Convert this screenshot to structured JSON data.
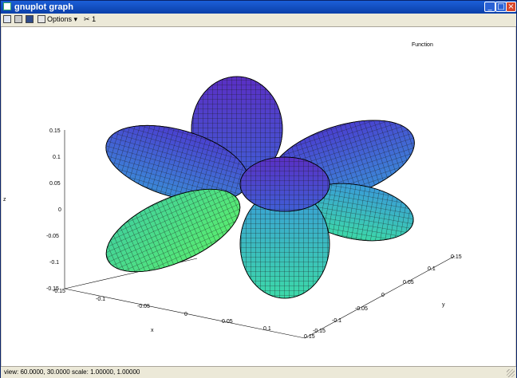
{
  "window": {
    "title": "gnuplot graph",
    "icons": {
      "app": "gnuplot-icon",
      "minimize": "minimize-icon",
      "maximize": "maximize-icon",
      "close": "close-icon"
    }
  },
  "toolbar": {
    "copy_icon": "copy-icon",
    "print_icon": "print-icon",
    "save_icon": "save-icon",
    "options_label": "Options",
    "options_arrow": "▾",
    "mouse_icon": "mouse-icon",
    "mouse_count": "1"
  },
  "plot": {
    "title": "Function",
    "z_ticks": [
      "0.15",
      "0.1",
      "0.05",
      "0",
      "-0.05",
      "-0.1",
      "-0.15"
    ],
    "x_ticks": [
      "-0.15",
      "-0.1",
      "-0.05",
      "0",
      "0.05",
      "0.1",
      "0.15"
    ],
    "y_ticks": [
      "-0.15",
      "-0.1",
      "-0.05",
      "0",
      "0.05",
      "0.1",
      "0.15"
    ],
    "x_label": "x",
    "y_label": "y",
    "z_label": "z",
    "colors": {
      "purple": "#5a35c8",
      "blue": "#3d6fd8",
      "teal": "#2fd8b8",
      "green": "#4ee870",
      "mesh": "#1a1a1a"
    }
  },
  "status": {
    "text": "view: 60.0000, 30.0000  scale: 1.00000, 1.00000"
  }
}
